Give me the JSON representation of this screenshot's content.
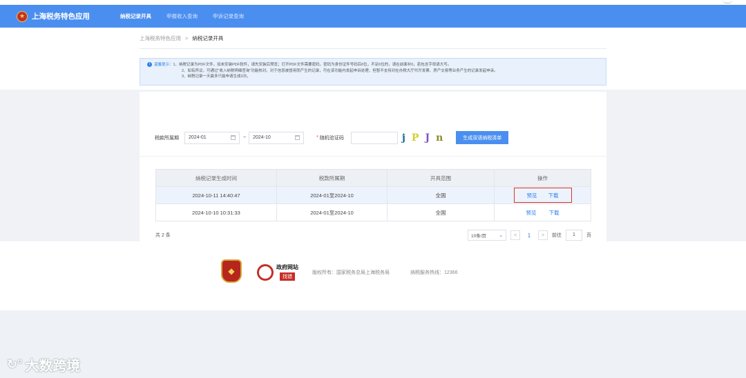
{
  "header": {
    "logo_text": "上海税务特色应用",
    "nav": [
      "纳税记录开具",
      "申报收入查询",
      "申诉记录查询"
    ]
  },
  "breadcrumb": {
    "root": "上海税务特色应用",
    "separator": ">",
    "current": "纳税记录开具"
  },
  "notice": {
    "tip_label": "温馨提示：",
    "line1": "1、纳税记录为PDF文件，如未安装PDF软件，请先安装后预览；打开PDF文件需要密码，密码为身份证件号码后6位，不足6位的，请在前面补0，若包含字母请大写。",
    "line2": "2、如有异议，可通过“收入纳税明细查询”功能核对。对于信息被冒用而产生的记录，可在该功能内发起申诉处理，但暂不支持对在办税大厅代开发票、房产交易等业务产生的记录发起申诉。",
    "line3": "3、纳税记录一天最多只能申请生成3次。"
  },
  "search": {
    "period_label": "税款所属期",
    "start": "2024-01",
    "dash": "~",
    "end": "2024-10",
    "req_mark": "*",
    "captcha_label": "随机验证码",
    "captcha_chars": [
      "j",
      "P",
      "J",
      "n"
    ],
    "generate_button": "生成双语纳税清单"
  },
  "table": {
    "headers": [
      "纳税记录生成时间",
      "税款所属期",
      "开具范围",
      "操作"
    ],
    "rows": [
      {
        "time": "2024-10-11 14:40:47",
        "period": "2024-01至2024-10",
        "scope": "全国",
        "preview": "预览",
        "download": "下载"
      },
      {
        "time": "2024-10-10 10:31:33",
        "period": "2024-01至2024-10",
        "scope": "全国",
        "preview": "预览",
        "download": "下载"
      }
    ]
  },
  "pagination": {
    "total": "共 2 条",
    "page_size": "10条/页",
    "prev": "<",
    "page": "1",
    "next": ">",
    "goto_label": "前往",
    "goto_value": "1",
    "page_unit": "页"
  },
  "footer": {
    "gov_title": "政府网站",
    "gov_sub": "找错",
    "copyright": "版权所有：国家税务总局上海税务局",
    "hotline": "纳税服务热线：12366"
  },
  "watermark": {
    "text": "大数跨境"
  },
  "colors": {
    "primary": "#4a8ff0",
    "link": "#2f80ed",
    "highlight_box": "#e0312a",
    "emblem": "#c62f28"
  }
}
